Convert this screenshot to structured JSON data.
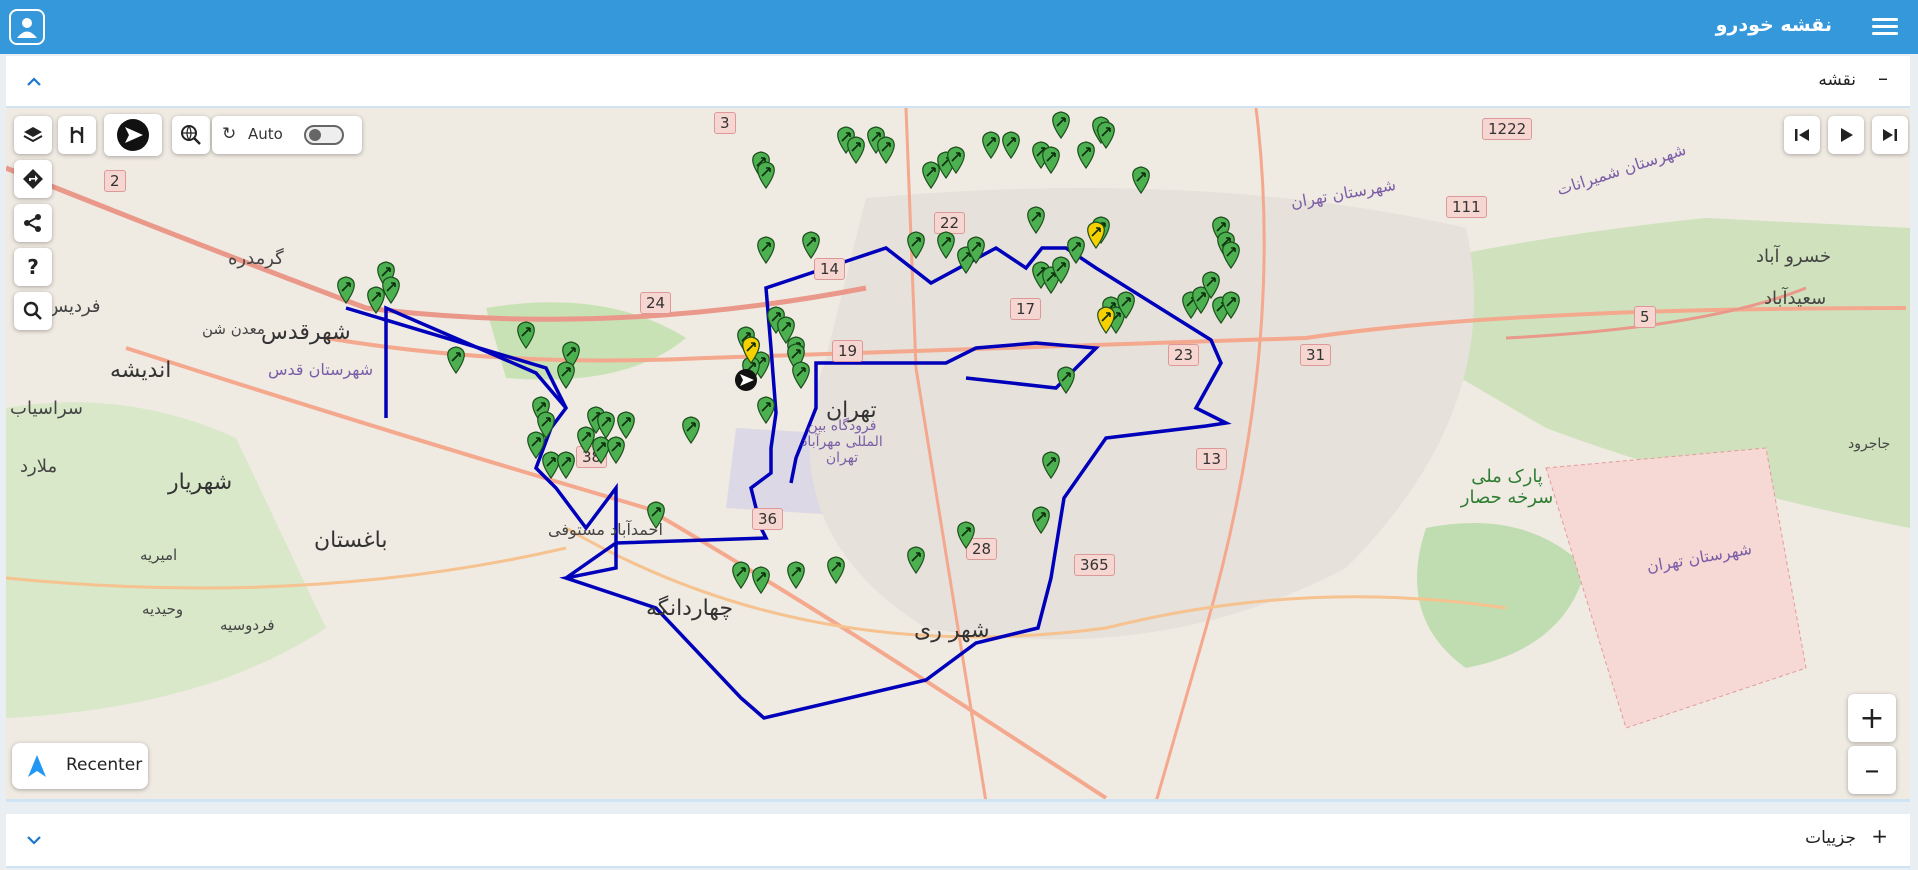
{
  "app": {
    "title": "نقشه خودرو"
  },
  "map_panel": {
    "title": "نقشه",
    "collapse_mark": "–"
  },
  "details_panel": {
    "title": "جزییات",
    "expand_mark": "+"
  },
  "toolbar": {
    "help_label": "?",
    "auto_label": "Auto",
    "recenter_label": "Recenter",
    "zoom_in": "+",
    "zoom_out": "–"
  },
  "map": {
    "places": {
      "tehran": "تهران",
      "shahr_qods": "شهرقدس",
      "qods_county": "شهرستان قدس",
      "andisheh": "اندیشه",
      "shahriar": "شهریار",
      "baghestan": "باغستان",
      "chahardangeh": "چهاردانگه",
      "shahr_rey": "شهر ری",
      "mellat_park": "پارک ملی سرخه حصار",
      "khosro_abad": "خسرو آباد",
      "saeed_abad": "سعیدآباد",
      "fardis": "فردیس",
      "malard": "ملارد",
      "sarasiab": "سراسیاب",
      "garmdareh": "گرمدره",
      "madan_shen": "معدن شن",
      "ahmadabad": "احمدآباد مستوفی",
      "amirieh": "امیریه",
      "vahidieh": "وحیدیه",
      "ferdowsieh": "فردوسیه",
      "mehrabad": "فرودگاه بین المللی مهرآباد تهران",
      "shemiranat": "شهرستان شمیرانات",
      "tehran_county": "شهرستان تهران",
      "tehran_county_north": "شهرستان تهران",
      "jajrood": "جاجرود"
    },
    "route_shields": [
      "3",
      "2",
      "1222",
      "22",
      "111",
      "14",
      "24",
      "17",
      "19",
      "5",
      "31",
      "23",
      "38",
      "13",
      "36",
      "28",
      "365"
    ],
    "colors": {
      "route": "#0000bb",
      "marker": "#4caf50",
      "marker_alert": "#f7d000",
      "header": "#3498db"
    }
  }
}
